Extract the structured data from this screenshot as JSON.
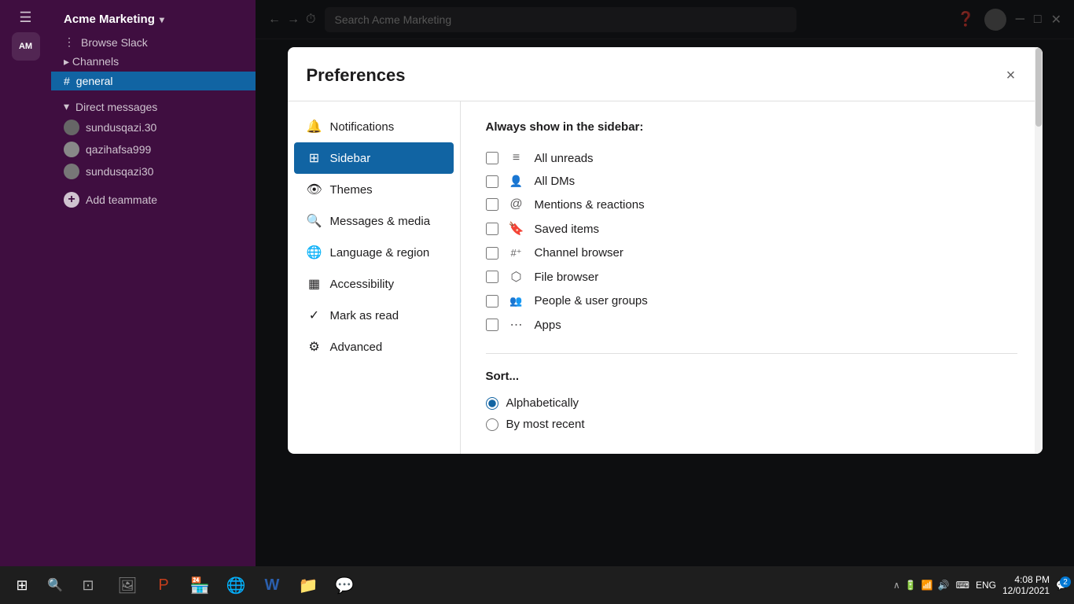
{
  "app": {
    "title": "Acme Marketing",
    "search_placeholder": "Search Acme Marketing"
  },
  "dialog": {
    "title": "Preferences",
    "close_label": "×"
  },
  "pref_nav": {
    "items": [
      {
        "id": "notifications",
        "label": "Notifications",
        "icon": "🔔"
      },
      {
        "id": "sidebar",
        "label": "Sidebar",
        "icon": "⊞",
        "active": true
      },
      {
        "id": "themes",
        "label": "Themes",
        "icon": "👁"
      },
      {
        "id": "messages",
        "label": "Messages & media",
        "icon": "🔍"
      },
      {
        "id": "language",
        "label": "Language & region",
        "icon": "🌐"
      },
      {
        "id": "accessibility",
        "label": "Accessibility",
        "icon": "▦"
      },
      {
        "id": "markasread",
        "label": "Mark as read",
        "icon": "✓"
      },
      {
        "id": "advanced",
        "label": "Advanced",
        "icon": "⚙"
      }
    ]
  },
  "sidebar_section": {
    "title": "Always show in the sidebar:",
    "items": [
      {
        "id": "all-unreads",
        "label": "All unreads",
        "icon": "≡",
        "checked": false
      },
      {
        "id": "all-dms",
        "label": "All DMs",
        "icon": "👤",
        "checked": false
      },
      {
        "id": "mentions-reactions",
        "label": "Mentions & reactions",
        "icon": "@",
        "checked": false
      },
      {
        "id": "saved-items",
        "label": "Saved items",
        "icon": "🔖",
        "checked": false
      },
      {
        "id": "channel-browser",
        "label": "Channel browser",
        "icon": "#⁺",
        "checked": false
      },
      {
        "id": "file-browser",
        "label": "File browser",
        "icon": "⬡",
        "checked": false
      },
      {
        "id": "people-user-groups",
        "label": "People & user groups",
        "icon": "👥",
        "checked": false
      },
      {
        "id": "apps",
        "label": "Apps",
        "icon": "⋯",
        "checked": false
      }
    ]
  },
  "sort_section": {
    "title": "Sort...",
    "options": [
      {
        "id": "alphabetically",
        "label": "Alphabetically",
        "checked": true
      },
      {
        "id": "most-recent",
        "label": "By most recent",
        "checked": false
      }
    ]
  },
  "taskbar": {
    "time": "4:08 PM",
    "date": "12/01/2021",
    "lang": "ENG",
    "notification_count": "2"
  },
  "slack_sidebar": {
    "workspace": "Acme Marketing",
    "channels_label": "Channels",
    "general_channel": "general",
    "direct_messages_label": "Direct messages",
    "dm_users": [
      "sundusqazi.30",
      "qazihafsa999",
      "sundusqazi30"
    ],
    "add_teammate": "Add teammate",
    "browse_slack": "Browse Slack"
  }
}
